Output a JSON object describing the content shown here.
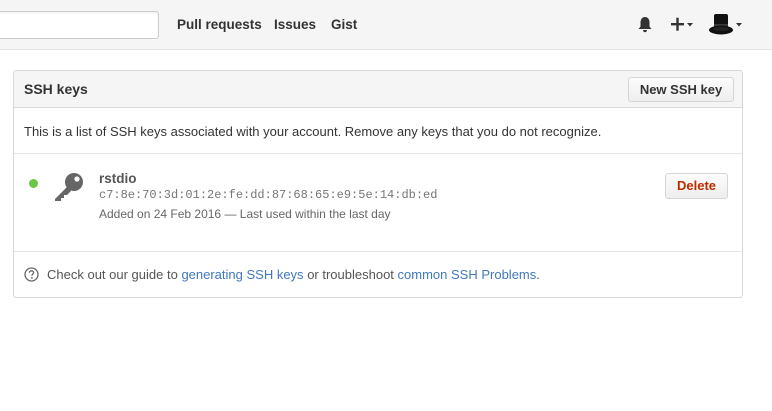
{
  "header": {
    "nav": {
      "pull_requests": "Pull requests",
      "issues": "Issues",
      "gist": "Gist"
    },
    "icons": {
      "notifications": "bell-icon",
      "create": "plus-icon",
      "create_caret": "caret-down-icon",
      "avatar": "top-hat-avatar",
      "avatar_caret": "caret-down-icon"
    }
  },
  "ssh_keys": {
    "title": "SSH keys",
    "new_button_label": "New SSH key",
    "intro": "This is a list of SSH keys associated with your account. Remove any keys that you do not recognize.",
    "keys": [
      {
        "title": "rstdio",
        "fingerprint": "c7:8e:70:3d:01:2e:fe:dd:87:68:65:e9:5e:14:db:ed",
        "meta": "Added on 24 Feb 2016 — Last used within the last day",
        "status_color": "#6cc644",
        "delete_label": "Delete"
      }
    ],
    "footer": {
      "prefix": "Check out our guide to",
      "link1": "generating SSH keys",
      "middle": "or troubleshoot",
      "link2": "common SSH Problems",
      "suffix": "."
    }
  },
  "colors": {
    "link": "#4078c0",
    "danger": "#bd2c00",
    "header_bg": "#f5f5f5"
  }
}
